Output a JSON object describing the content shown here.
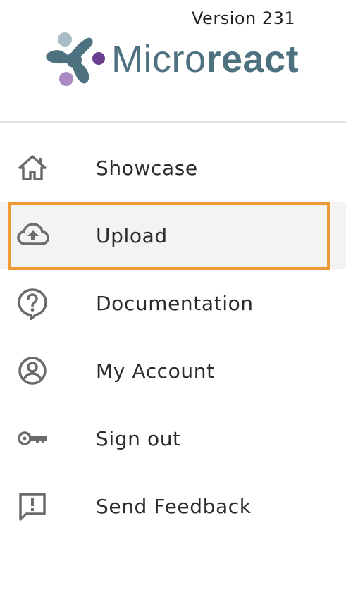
{
  "header": {
    "version": "Version 231",
    "logo": {
      "text_light": "Micro",
      "text_bold": "react",
      "colors": {
        "text": "#4e7180",
        "node_gray": "#a7bcc4",
        "node_purple": "#6b3d8e",
        "node_lilac": "#a98ac4"
      }
    }
  },
  "menu": {
    "items": [
      {
        "label": "Showcase",
        "icon": "home-icon",
        "selected": false
      },
      {
        "label": "Upload",
        "icon": "cloud-upload-icon",
        "selected": true
      },
      {
        "label": "Documentation",
        "icon": "help-bubble-icon",
        "selected": false
      },
      {
        "label": "My Account",
        "icon": "account-circle-icon",
        "selected": false
      },
      {
        "label": "Sign out",
        "icon": "key-icon",
        "selected": false
      },
      {
        "label": "Send Feedback",
        "icon": "feedback-icon",
        "selected": false
      }
    ]
  },
  "colors": {
    "highlight_border": "#ef9a36",
    "selected_background": "#f3f3f3",
    "icon": "#6b6b6b",
    "divider": "#e3e3e3"
  }
}
